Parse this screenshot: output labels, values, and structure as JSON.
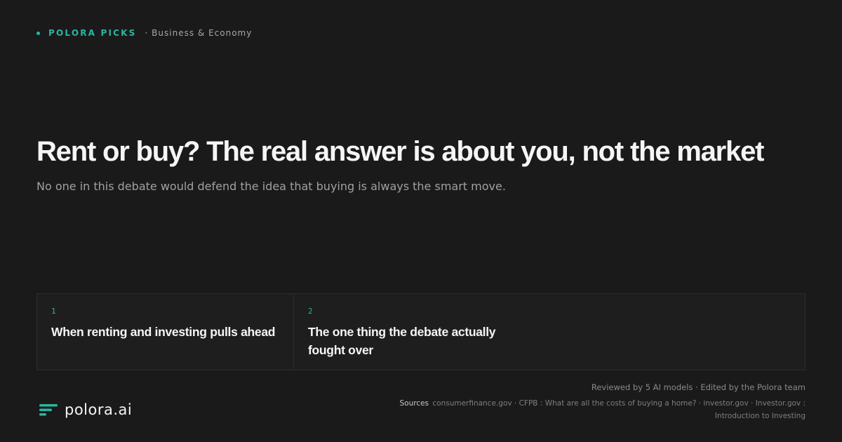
{
  "topbar": {
    "brand": "POLORA PICKS",
    "category": "· Business & Economy"
  },
  "headline": "Rent or buy? The real answer is about you, not the market",
  "subhead": "No one in this debate would defend the idea that buying is always the smart move.",
  "cards": [
    {
      "num": "1",
      "title": "When renting and investing pulls ahead"
    },
    {
      "num": "2",
      "title": "The one thing the debate actually fought over"
    }
  ],
  "footer": {
    "logo_text": "polora.ai",
    "reviewed": "Reviewed by 5 AI models · Edited by the Polora team",
    "sources_label": "Sources",
    "sources_line1": "consumerfinance.gov · CFPB : What are all the costs of buying a home? · investor.gov · Investor.gov :",
    "sources_line2": "Introduction to Investing"
  },
  "colors": {
    "accent": "#2bb5a0",
    "background": "#1a1a1a"
  },
  "icons": {
    "logo": "polora-logo-icon",
    "dot": "dot-icon"
  }
}
